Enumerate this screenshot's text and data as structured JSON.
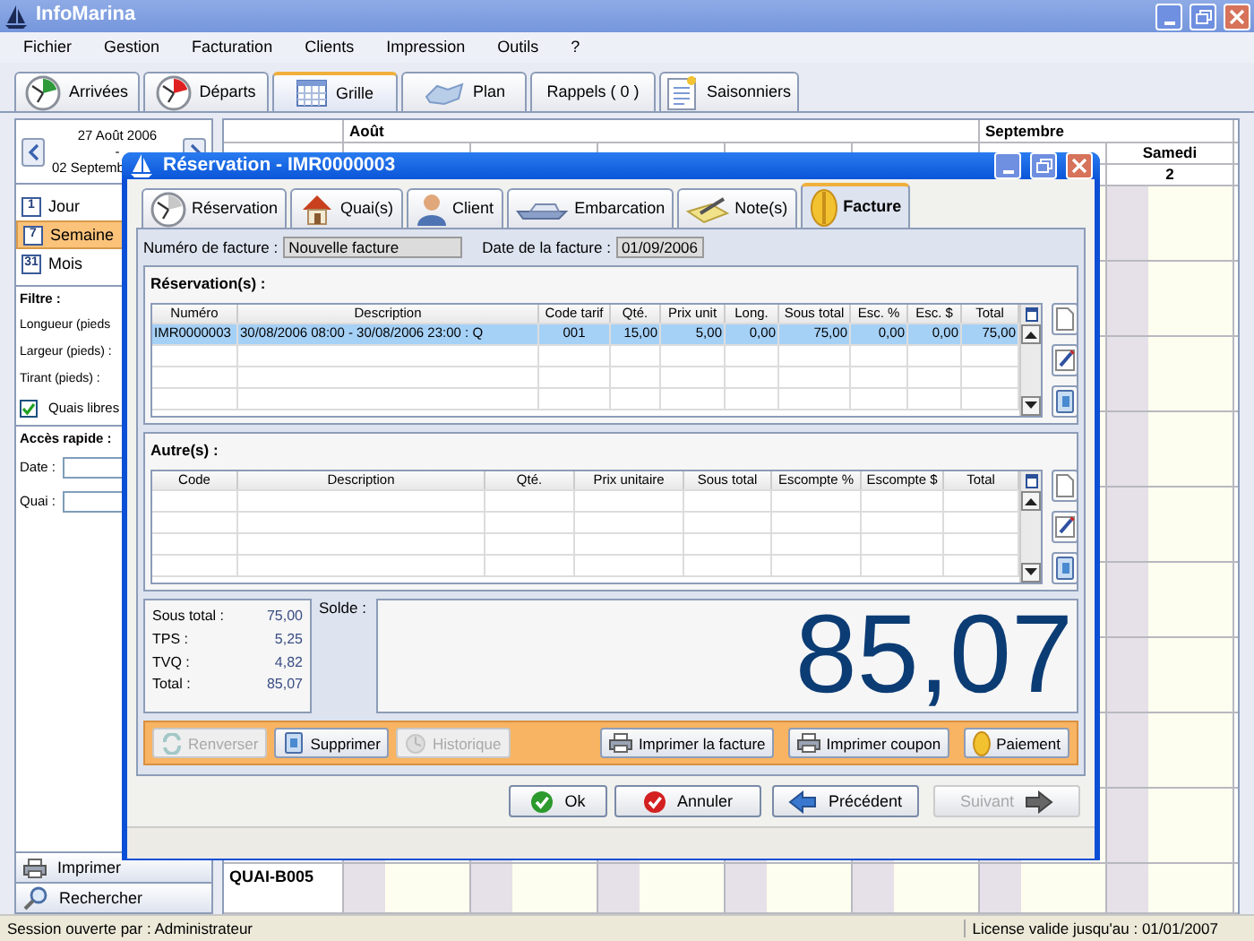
{
  "window": {
    "title": "InfoMarina"
  },
  "menu": [
    "Fichier",
    "Gestion",
    "Facturation",
    "Clients",
    "Impression",
    "Outils",
    "?"
  ],
  "main_tabs": [
    {
      "label": "Arrivées",
      "kind": "arrivals",
      "selected": false
    },
    {
      "label": "Départs",
      "kind": "departures",
      "selected": false
    },
    {
      "label": "Grille",
      "kind": "grid",
      "selected": true
    },
    {
      "label": "Plan",
      "kind": "plan",
      "selected": false
    },
    {
      "label": "Rappels ( 0 )",
      "kind": "reminders",
      "selected": false
    },
    {
      "label": "Saisonniers",
      "kind": "seasonal",
      "selected": false
    }
  ],
  "date_nav": {
    "start": "27 Août 2006",
    "separator": "-",
    "end": "02 Septemb"
  },
  "views": [
    {
      "icon_text": "1",
      "label": "Jour",
      "selected": false
    },
    {
      "icon_text": "7",
      "label": "Semaine",
      "selected": true
    },
    {
      "icon_text": "31",
      "label": "Mois",
      "selected": false
    }
  ],
  "filter": {
    "title": "Filtre :",
    "fields": [
      "Longueur (pieds",
      "Largeur (pieds) :",
      "Tirant (pieds) :"
    ],
    "checkbox": {
      "label": "Quais libres",
      "checked": true
    }
  },
  "quick_access": {
    "title": "Accès rapide :",
    "fields": [
      "Date :",
      "Quai :"
    ]
  },
  "side_actions": [
    {
      "label": "Imprimer",
      "kind": "print"
    },
    {
      "label": "Rechercher",
      "kind": "search"
    }
  ],
  "grid": {
    "months": [
      "Août",
      "Septembre"
    ],
    "visible_day": {
      "name": "Samedi",
      "number": "2"
    },
    "rows": [
      "QUAI-B005"
    ]
  },
  "dialog": {
    "title": "Réservation - IMR0000003",
    "tabs": [
      {
        "label": "Réservation",
        "kind": "reservation",
        "selected": false
      },
      {
        "label": "Quai(s)",
        "kind": "berth",
        "selected": false
      },
      {
        "label": "Client",
        "kind": "client",
        "selected": false
      },
      {
        "label": "Embarcation",
        "kind": "boat",
        "selected": false
      },
      {
        "label": "Note(s)",
        "kind": "note",
        "selected": false
      },
      {
        "label": "Facture",
        "kind": "invoice",
        "selected": true
      }
    ],
    "invoice": {
      "number_label": "Numéro de facture :",
      "number": "Nouvelle facture",
      "date_label": "Date de la facture :",
      "date": "01/09/2006"
    },
    "reservations": {
      "title": "Réservation(s) :",
      "columns": [
        "Numéro",
        "Description",
        "Code tarif",
        "Qté.",
        "Prix unit",
        "Long.",
        "Sous total",
        "Esc. %",
        "Esc. $",
        "Total"
      ],
      "rows": [
        {
          "selected": true,
          "cells": [
            "IMR0000003",
            "30/08/2006 08:00 - 30/08/2006 23:00 : Q",
            "001",
            "15,00",
            "5,00",
            "0,00",
            "75,00",
            "0,00",
            "0,00",
            "75,00"
          ]
        }
      ]
    },
    "others": {
      "title": "Autre(s) :",
      "columns": [
        "Code",
        "Description",
        "Qté.",
        "Prix unitaire",
        "Sous total",
        "Escompte %",
        "Escompte $",
        "Total"
      ]
    },
    "totals": [
      {
        "label": "Sous total :",
        "value": "75,00"
      },
      {
        "label": "TPS :",
        "value": "5,25"
      },
      {
        "label": "TVQ :",
        "value": "4,82"
      },
      {
        "label": "Total :",
        "value": "85,07"
      }
    ],
    "balance": {
      "label": "Solde :",
      "value": "85,07"
    },
    "actions_left": [
      {
        "label": "Renverser",
        "kind": "reverse",
        "disabled": true
      },
      {
        "label": "Supprimer",
        "kind": "delete",
        "disabled": false
      },
      {
        "label": "Historique",
        "kind": "history",
        "disabled": true
      }
    ],
    "actions_right": [
      {
        "label": "Imprimer la facture",
        "kind": "print",
        "disabled": false
      },
      {
        "label": "Imprimer coupon",
        "kind": "print",
        "disabled": false
      },
      {
        "label": "Paiement",
        "kind": "payment",
        "disabled": false
      }
    ],
    "buttons": [
      {
        "label": "Ok",
        "kind": "ok",
        "disabled": false
      },
      {
        "label": "Annuler",
        "kind": "cancel",
        "disabled": false
      },
      {
        "label": "Précédent",
        "kind": "previous",
        "disabled": false
      },
      {
        "label": "Suivant",
        "kind": "next",
        "disabled": true
      }
    ]
  },
  "status_bar": {
    "left": "Session ouverte par : Administrateur",
    "right": "License valide jusqu'au : 01/01/2007"
  }
}
